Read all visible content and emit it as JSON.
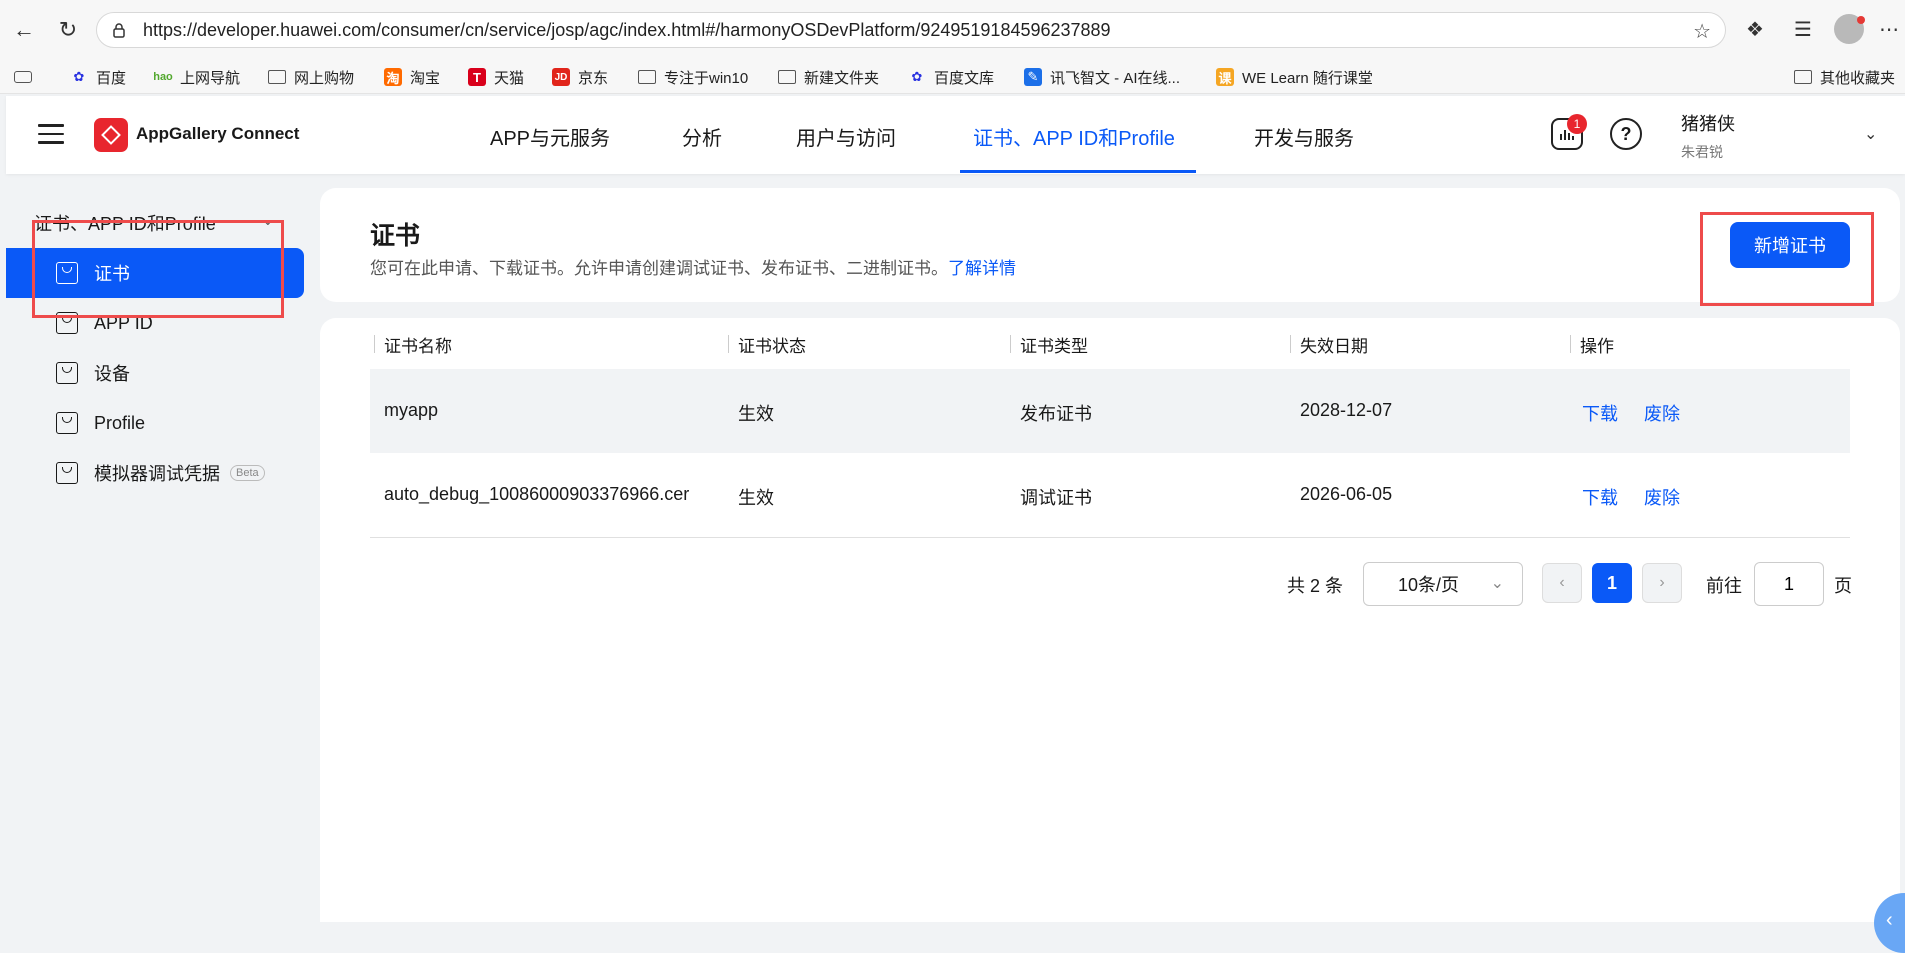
{
  "browser": {
    "url": "https://developer.huawei.com/consumer/cn/service/josp/agc/index.html#/harmonyOSDevPlatform/9249519184596237889",
    "bookmarks": [
      "百度",
      "上网导航",
      "网上购物",
      "淘宝",
      "天猫",
      "京东",
      "专注于win10",
      "新建文件夹",
      "百度文库",
      "讯飞智文 - AI在线...",
      "WE Learn 随行课堂"
    ],
    "other_bookmarks": "其他收藏夹"
  },
  "header": {
    "app_name": "AppGallery Connect",
    "nav": [
      "APP与元服务",
      "分析",
      "用户与访问",
      "证书、APP ID和Profile",
      "开发与服务"
    ],
    "active_nav": "证书、APP ID和Profile",
    "notification_count": "1",
    "user_name": "猪猪侠",
    "user_sub": "朱君锐"
  },
  "sidebar": {
    "title": "证书、APP ID和Profile",
    "items": [
      {
        "label": "证书",
        "active": true
      },
      {
        "label": "APP ID"
      },
      {
        "label": "设备"
      },
      {
        "label": "Profile"
      },
      {
        "label": "模拟器调试凭据",
        "badge": "Beta"
      }
    ]
  },
  "main": {
    "title": "证书",
    "description": "您可在此申请、下载证书。允许申请创建调试证书、发布证书、二进制证书。",
    "learn_more": "了解详情",
    "add_button": "新增证书"
  },
  "table": {
    "headers": [
      "证书名称",
      "证书状态",
      "证书类型",
      "失效日期",
      "操作"
    ],
    "rows": [
      {
        "name": "myapp",
        "status": "生效",
        "type": "发布证书",
        "expiry": "2028-12-07",
        "download": "下载",
        "revoke": "废除"
      },
      {
        "name": "auto_debug_10086000903376966.cer",
        "status": "生效",
        "type": "调试证书",
        "expiry": "2026-06-05",
        "download": "下载",
        "revoke": "废除"
      }
    ]
  },
  "pagination": {
    "total": "共 2 条",
    "page_size": "10条/页",
    "current_page": "1",
    "goto_label": "前往",
    "goto_value": "1",
    "page_unit": "页"
  },
  "colors": {
    "accent": "#0a59f7",
    "annotation": "#ee4b4b",
    "brand": "#e8262e"
  }
}
